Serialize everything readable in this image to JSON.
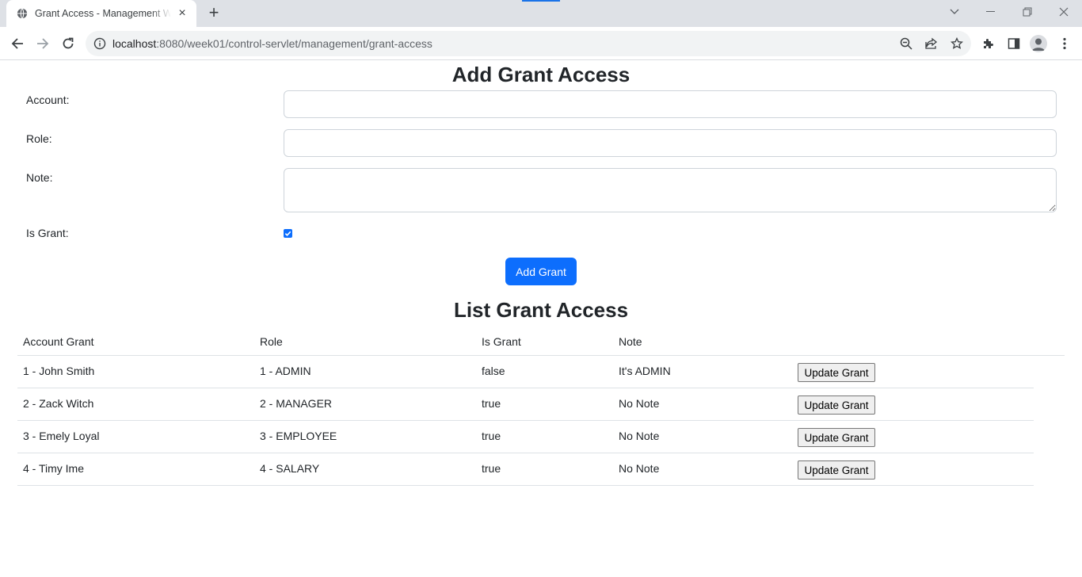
{
  "browser": {
    "tab_title": "Grant Access - Management Web",
    "url_host": "localhost",
    "url_path": ":8080/week01/control-servlet/management/grant-access"
  },
  "form": {
    "title": "Add Grant Access",
    "account_label": "Account:",
    "account_value": "",
    "role_label": "Role:",
    "role_value": "",
    "note_label": "Note:",
    "note_value": "",
    "is_grant_label": "Is Grant:",
    "is_grant_checked": true,
    "submit_label": "Add Grant"
  },
  "list": {
    "title": "List Grant Access",
    "columns": [
      "Account Grant",
      "Role",
      "Is Grant",
      "Note"
    ],
    "rows": [
      {
        "account": "1 - John Smith",
        "role": "1 - ADMIN",
        "is_grant": "false",
        "note": "It's ADMIN",
        "action": "Update Grant"
      },
      {
        "account": "2 - Zack Witch",
        "role": "2 - MANAGER",
        "is_grant": "true",
        "note": "No Note",
        "action": "Update Grant"
      },
      {
        "account": "3 - Emely Loyal",
        "role": "3 - EMPLOYEE",
        "is_grant": "true",
        "note": "No Note",
        "action": "Update Grant"
      },
      {
        "account": "4 - Timy Ime",
        "role": "4 - SALARY",
        "is_grant": "true",
        "note": "No Note",
        "action": "Update Grant"
      }
    ]
  },
  "colors": {
    "primary": "#0d6efd",
    "chrome_bg": "#dee1e6",
    "omnibox_bg": "#f1f3f4"
  }
}
